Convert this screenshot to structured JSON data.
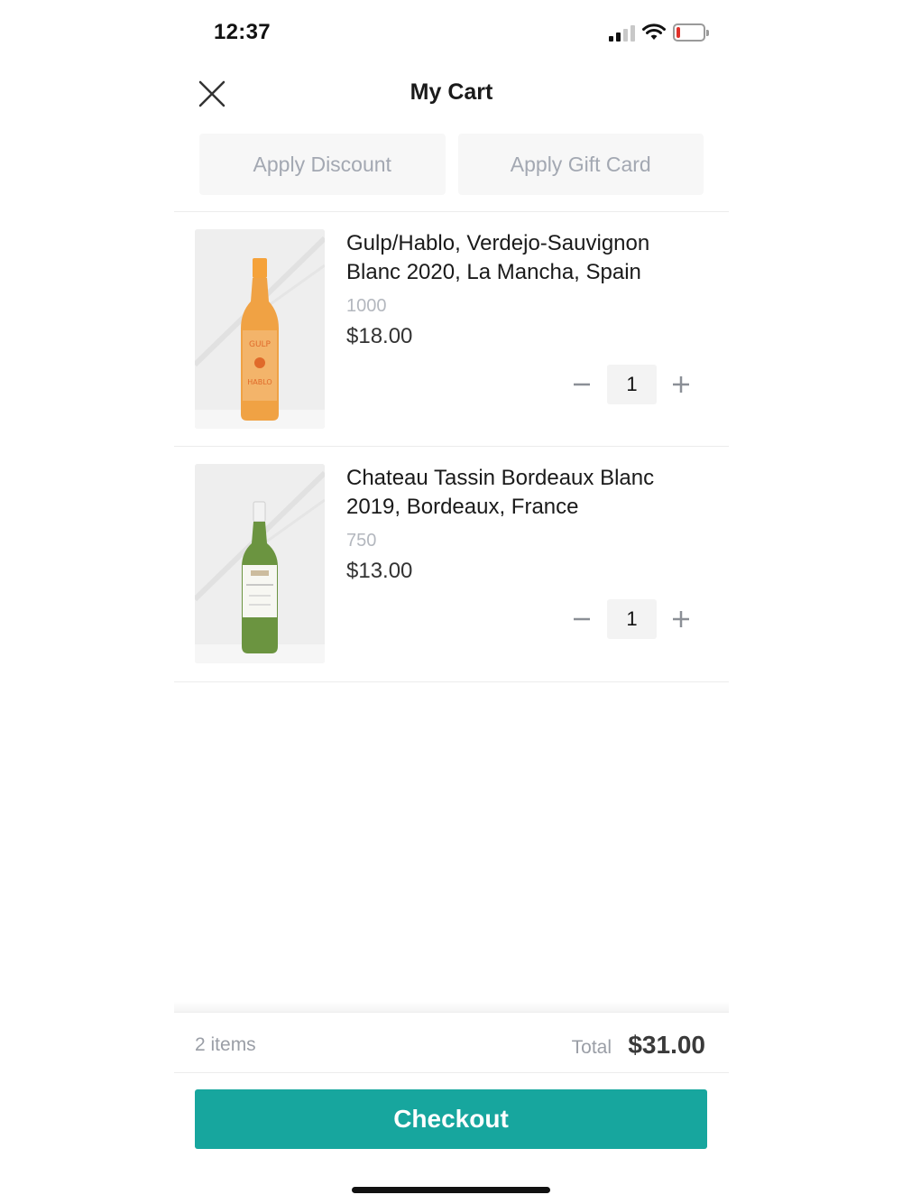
{
  "status_bar": {
    "time": "12:37",
    "battery_level": 0.15,
    "battery_color": "#e0312b",
    "signal_bars_active": 2,
    "signal_bars_total": 4
  },
  "header": {
    "title": "My Cart",
    "close_icon": "close-icon"
  },
  "promo": {
    "apply_discount_label": "Apply Discount",
    "apply_gift_card_label": "Apply Gift Card"
  },
  "cart": {
    "items": [
      {
        "name": "Gulp/Hablo, Verdejo-Sauvignon Blanc 2020, La Mancha, Spain",
        "size": "1000",
        "price": "$18.00",
        "quantity": "1",
        "bottle_color": "#f0a244"
      },
      {
        "name": "Chateau Tassin Bordeaux Blanc 2019, Bordeaux, France",
        "size": "750",
        "price": "$13.00",
        "quantity": "1",
        "bottle_color": "#5e8a3a"
      }
    ]
  },
  "summary": {
    "items_count": "2 items",
    "total_label": "Total",
    "total_value": "$31.00"
  },
  "checkout": {
    "label": "Checkout",
    "color": "#17a69e"
  }
}
